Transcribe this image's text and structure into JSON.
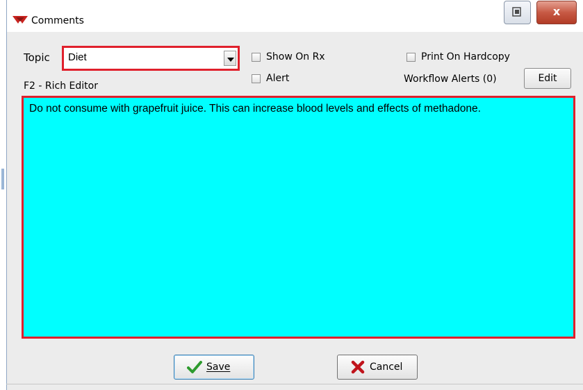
{
  "window": {
    "title": "Comments",
    "close_glyph": "x",
    "restore_icon": "restore-icon"
  },
  "form": {
    "topic_label": "Topic",
    "topic_value": "Diet",
    "show_on_rx": "Show On Rx",
    "alert": "Alert",
    "print_on_hardcopy": "Print On Hardcopy",
    "editor_hint": "F2 - Rich Editor",
    "workflow_alerts": "Workflow Alerts (0)",
    "edit_label": "Edit",
    "comment_text": "Do not consume with grapefruit juice. This can increase blood levels and effects of methadone."
  },
  "buttons": {
    "save": "Save",
    "cancel": "Cancel"
  },
  "colors": {
    "accent_red": "#e0202c",
    "comment_bg": "#00ffff",
    "save_check": "#2e9b2e",
    "cancel_x": "#c0141c"
  }
}
